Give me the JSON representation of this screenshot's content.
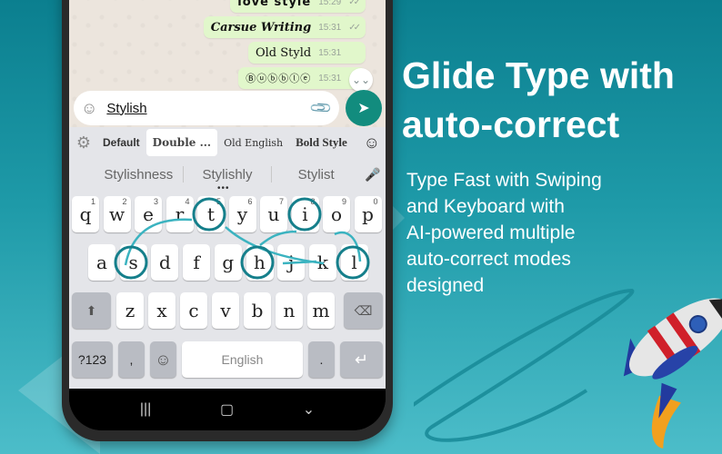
{
  "chat": {
    "messages": [
      {
        "text": "love style",
        "time": "15:29",
        "status": "read",
        "style": "love"
      },
      {
        "text": "Carsue Writing",
        "time": "15:31",
        "status": "read",
        "style": "cursive"
      },
      {
        "text": "Old Styld",
        "time": "15:31",
        "status": "read",
        "style": "old"
      },
      {
        "text": "Ⓑⓤⓑⓑⓛⓔ",
        "time": "15:31",
        "status": "read",
        "style": "bubble"
      }
    ],
    "scroll_down_icon": "⌄⌄",
    "tick_icon": "✓✓"
  },
  "input": {
    "value": "Stylish",
    "emoji_icon": "☺",
    "attach_icon": "📎",
    "send_icon": "➤"
  },
  "keyboard": {
    "toolbar": {
      "gear_icon": "⚙",
      "styles": [
        "Default",
        "Double ...",
        "Old English",
        "Bold Style"
      ],
      "selected_style": "Double ...",
      "emoji_icon": "☺"
    },
    "suggestions": [
      "Stylishness",
      "Stylishly",
      "Stylist"
    ],
    "mic_icon": "🎤",
    "more_dots": "•••",
    "row1": [
      {
        "key": "q",
        "num": "1"
      },
      {
        "key": "w",
        "num": "2"
      },
      {
        "key": "e",
        "num": "3"
      },
      {
        "key": "r",
        "num": "4"
      },
      {
        "key": "t",
        "num": "5"
      },
      {
        "key": "y",
        "num": "6"
      },
      {
        "key": "u",
        "num": "7"
      },
      {
        "key": "i",
        "num": "8"
      },
      {
        "key": "o",
        "num": "9"
      },
      {
        "key": "p",
        "num": "0"
      }
    ],
    "row2": [
      "a",
      "s",
      "d",
      "f",
      "g",
      "h",
      "j",
      "k",
      "l"
    ],
    "row3": [
      "z",
      "x",
      "c",
      "v",
      "b",
      "n",
      "m"
    ],
    "shift_icon": "⬆",
    "backspace_icon": "⌫",
    "symbols_label": "?123",
    "comma_label": ",",
    "emoji_key_icon": "☺",
    "space_label": "English",
    "period_label": ".",
    "enter_icon": "↵",
    "swipe_word_letters": [
      "s",
      "t",
      "y",
      "l",
      "i",
      "s",
      "h"
    ]
  },
  "navbar": {
    "recents_icon": "|||",
    "home_icon": "▢",
    "back_icon": "⌄"
  },
  "promo": {
    "headline_line1": "Glide Type with",
    "headline_line2": "auto-correct",
    "subtext_lines": [
      "Type Fast with Swiping",
      "and Keyboard with",
      "AI-powered multiple",
      "auto-correct modes",
      "designed"
    ]
  },
  "colors": {
    "accent": "#128c7e",
    "swipe_trail": "#1a8c99",
    "bubble_bg": "#e1f7cb"
  }
}
